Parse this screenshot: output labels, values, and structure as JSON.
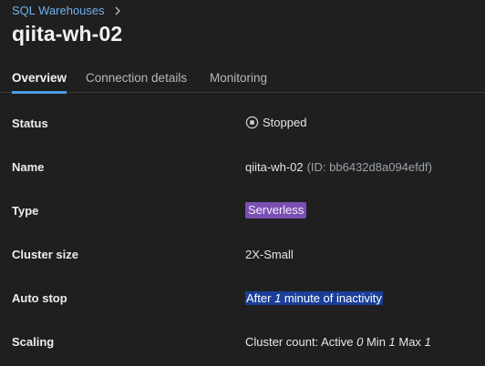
{
  "breadcrumb": {
    "parent": "SQL Warehouses",
    "separator_icon": "chevron-right-icon"
  },
  "page": {
    "title": "qiita-wh-02"
  },
  "tabs": [
    {
      "label": "Overview",
      "active": true
    },
    {
      "label": "Connection details",
      "active": false
    },
    {
      "label": "Monitoring",
      "active": false
    }
  ],
  "details": {
    "status": {
      "label": "Status",
      "value": "Stopped",
      "icon": "stop-circle-icon"
    },
    "name": {
      "label": "Name",
      "value": "qiita-wh-02",
      "id_text": "(ID: bb6432d8a094efdf)"
    },
    "type": {
      "label": "Type",
      "value": "Serverless",
      "badge_color": "#7a4fb2"
    },
    "cluster_size": {
      "label": "Cluster size",
      "value": "2X-Small"
    },
    "auto_stop": {
      "label": "Auto stop",
      "prefix": "After ",
      "minutes": "1",
      "suffix": " minute of inactivity",
      "highlight_color": "#1a3f99"
    },
    "scaling": {
      "label": "Scaling",
      "prefix": "Cluster count: Active ",
      "active": "0",
      "min_label": " Min ",
      "min": "1",
      "max_label": " Max ",
      "max": "1"
    }
  },
  "colors": {
    "background": "#1f1f1f",
    "link": "#6fb1ee",
    "tab_accent": "#4a9be8"
  }
}
